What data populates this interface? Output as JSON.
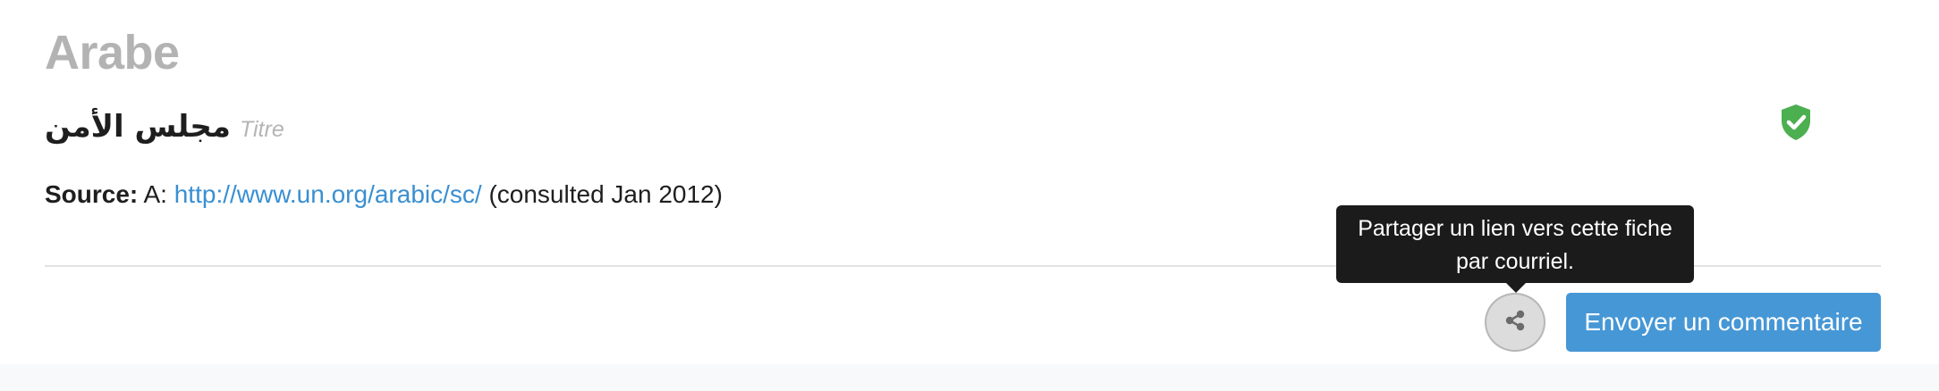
{
  "entry": {
    "language": "Arabe",
    "term": "مجلس الأمن",
    "term_type": "Titre",
    "verified_icon": "shield-check-icon"
  },
  "source": {
    "label": "Source:",
    "prefix": "A:",
    "link_text": "http://www.un.org/arabic/sc/",
    "suffix": "(consulted Jan 2012)"
  },
  "actions": {
    "share_tooltip": "Partager un lien vers cette fiche par courriel.",
    "share_icon": "share-icon",
    "feedback_label": "Envoyer un commentaire"
  },
  "colors": {
    "accent": "#4697d6",
    "link": "#3a8fd0",
    "verified": "#4caf50",
    "tooltip_bg": "#1b1b1b"
  }
}
